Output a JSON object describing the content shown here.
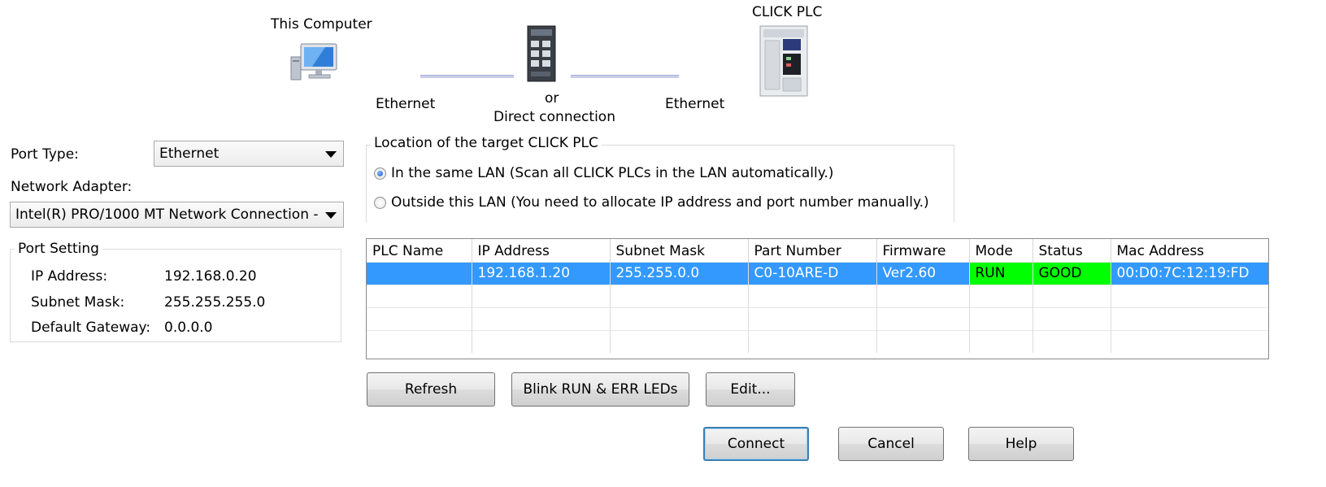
{
  "diagram": {
    "computer_label": "This Computer",
    "plc_label": "CLICK PLC",
    "ethernet_left": "Ethernet",
    "ethernet_right": "Ethernet",
    "or_label": "or",
    "direct_label": "Direct connection"
  },
  "port": {
    "port_type_label": "Port Type:",
    "port_type_value": "Ethernet",
    "adapter_label": "Network Adapter:",
    "adapter_value": "Intel(R) PRO/1000 MT Network Connection -"
  },
  "port_setting": {
    "title": "Port Setting",
    "ip_label": "IP Address:",
    "ip_value": "192.168.0.20",
    "mask_label": "Subnet Mask:",
    "mask_value": "255.255.255.0",
    "gateway_label": "Default Gateway:",
    "gateway_value": "0.0.0.0"
  },
  "location": {
    "title": "Location of the target CLICK PLC",
    "option_same_lan": "In the same LAN (Scan all CLICK PLCs in the LAN automatically.)",
    "option_outside_lan": "Outside this LAN (You need to allocate IP address and port number manually.)",
    "selected": "same_lan"
  },
  "plc_table": {
    "headers": [
      "PLC Name",
      "IP Address",
      "Subnet Mask",
      "Part Number",
      "Firmware",
      "Mode",
      "Status",
      "Mac Address"
    ],
    "rows": [
      {
        "plc_name": "",
        "ip": "192.168.1.20",
        "mask": "255.255.0.0",
        "part": "C0-10ARE-D",
        "firmware": "Ver2.60",
        "mode": "RUN",
        "status": "GOOD",
        "mac": "00:D0:7C:12:19:FD"
      }
    ],
    "selected_color": "#3399ff",
    "status_ok_color": "#00ff00"
  },
  "buttons": {
    "refresh": "Refresh",
    "blink": "Blink RUN & ERR LEDs",
    "edit": "Edit...",
    "connect": "Connect",
    "cancel": "Cancel",
    "help": "Help"
  },
  "icons": [
    "computer-icon",
    "ethernet-switch-icon",
    "click-plc-icon",
    "dropdown-arrow-icon"
  ]
}
